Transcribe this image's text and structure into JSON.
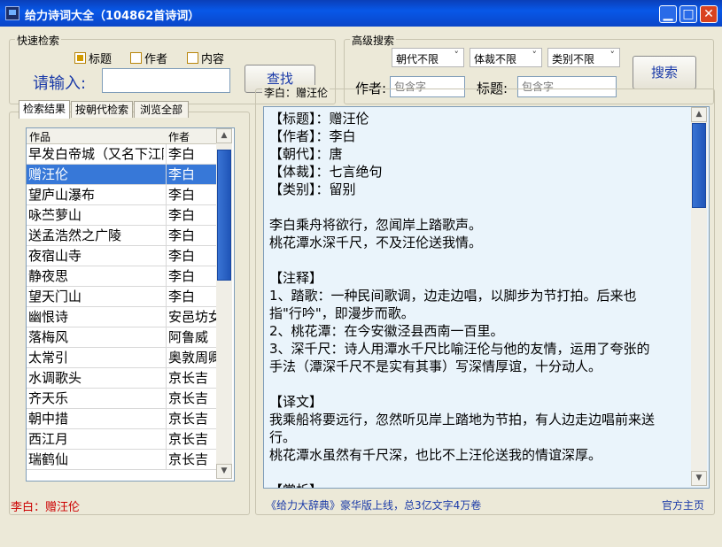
{
  "window": {
    "title": "给力诗词大全（104862首诗词）"
  },
  "quick_search": {
    "title": "快速检索",
    "options": [
      {
        "label": "标题",
        "checked": true
      },
      {
        "label": "作者",
        "checked": false
      },
      {
        "label": "内容",
        "checked": false
      }
    ],
    "input_label": "请输入:",
    "input_value": "",
    "button_label": "查找"
  },
  "advanced_search": {
    "title": "高级搜索",
    "dynasty": "朝代不限",
    "genre": "体裁不限",
    "category": "类别不限",
    "author_label": "作者:",
    "author_placeholder": "包含字",
    "title_label": "标题:",
    "title_placeholder": "包含字",
    "button_label": "搜索"
  },
  "tabs": [
    "检索结果",
    "按朝代检索",
    "浏览全部"
  ],
  "list": {
    "columns": [
      "作品",
      "作者"
    ],
    "rows": [
      {
        "title": "早发白帝城（又名下江陵）",
        "author": "李白"
      },
      {
        "title": "赠汪伦",
        "author": "李白",
        "selected": true
      },
      {
        "title": "望庐山瀑布",
        "author": "李白"
      },
      {
        "title": "咏苎萝山",
        "author": "李白"
      },
      {
        "title": "送孟浩然之广陵",
        "author": "李白"
      },
      {
        "title": "夜宿山寺",
        "author": "李白"
      },
      {
        "title": "静夜思",
        "author": "李白"
      },
      {
        "title": "望天门山",
        "author": "李白"
      },
      {
        "title": "幽恨诗",
        "author": "安邑坊女"
      },
      {
        "title": "落梅风",
        "author": "阿鲁威"
      },
      {
        "title": "太常引",
        "author": "奥敦周卿"
      },
      {
        "title": "水调歌头",
        "author": "京长吉"
      },
      {
        "title": "齐天乐",
        "author": "京长吉"
      },
      {
        "title": "朝中措",
        "author": "京长吉"
      },
      {
        "title": "西江月",
        "author": "京长吉"
      },
      {
        "title": "瑞鹤仙",
        "author": "京长吉"
      }
    ]
  },
  "detail": {
    "title": "李白：赠汪伦",
    "lines": [
      "【标题】：赠汪伦",
      "【作者】：李白",
      "【朝代】：唐",
      "【体裁】：七言绝句",
      "【类别】：留别",
      "",
      "李白乘舟将欲行，忽闻岸上踏歌声。",
      "桃花潭水深千尺，不及汪伦送我情。",
      "",
      "【注释】",
      "1、踏歌：一种民间歌调，边走边唱，以脚步为节打拍。后来也",
      "指\"行吟\"，即漫步而歌。",
      "2、桃花潭：在今安徽泾县西南一百里。",
      "3、深千尺：诗人用潭水千尺比喻汪伦与他的友情，运用了夸张的",
      "手法（潭深千尺不是实有其事）写深情厚谊，十分动人。",
      "",
      "【译文】",
      "我乘船将要远行，忽然听见岸上踏地为节拍，有人边走边唱前来送",
      "行。",
      "桃花潭水虽然有千尺深，也比不上汪伦送我的情谊深厚。",
      "",
      "【赏析】"
    ]
  },
  "status": {
    "left": "李白：赠汪伦",
    "center": "《给力大辞典》豪华版上线，总3亿文字4万卷",
    "right": "官方主页"
  },
  "colors": {
    "accent": "#1a3aa8",
    "status_left": "#cc0000",
    "selected_row": "#3778d8"
  }
}
